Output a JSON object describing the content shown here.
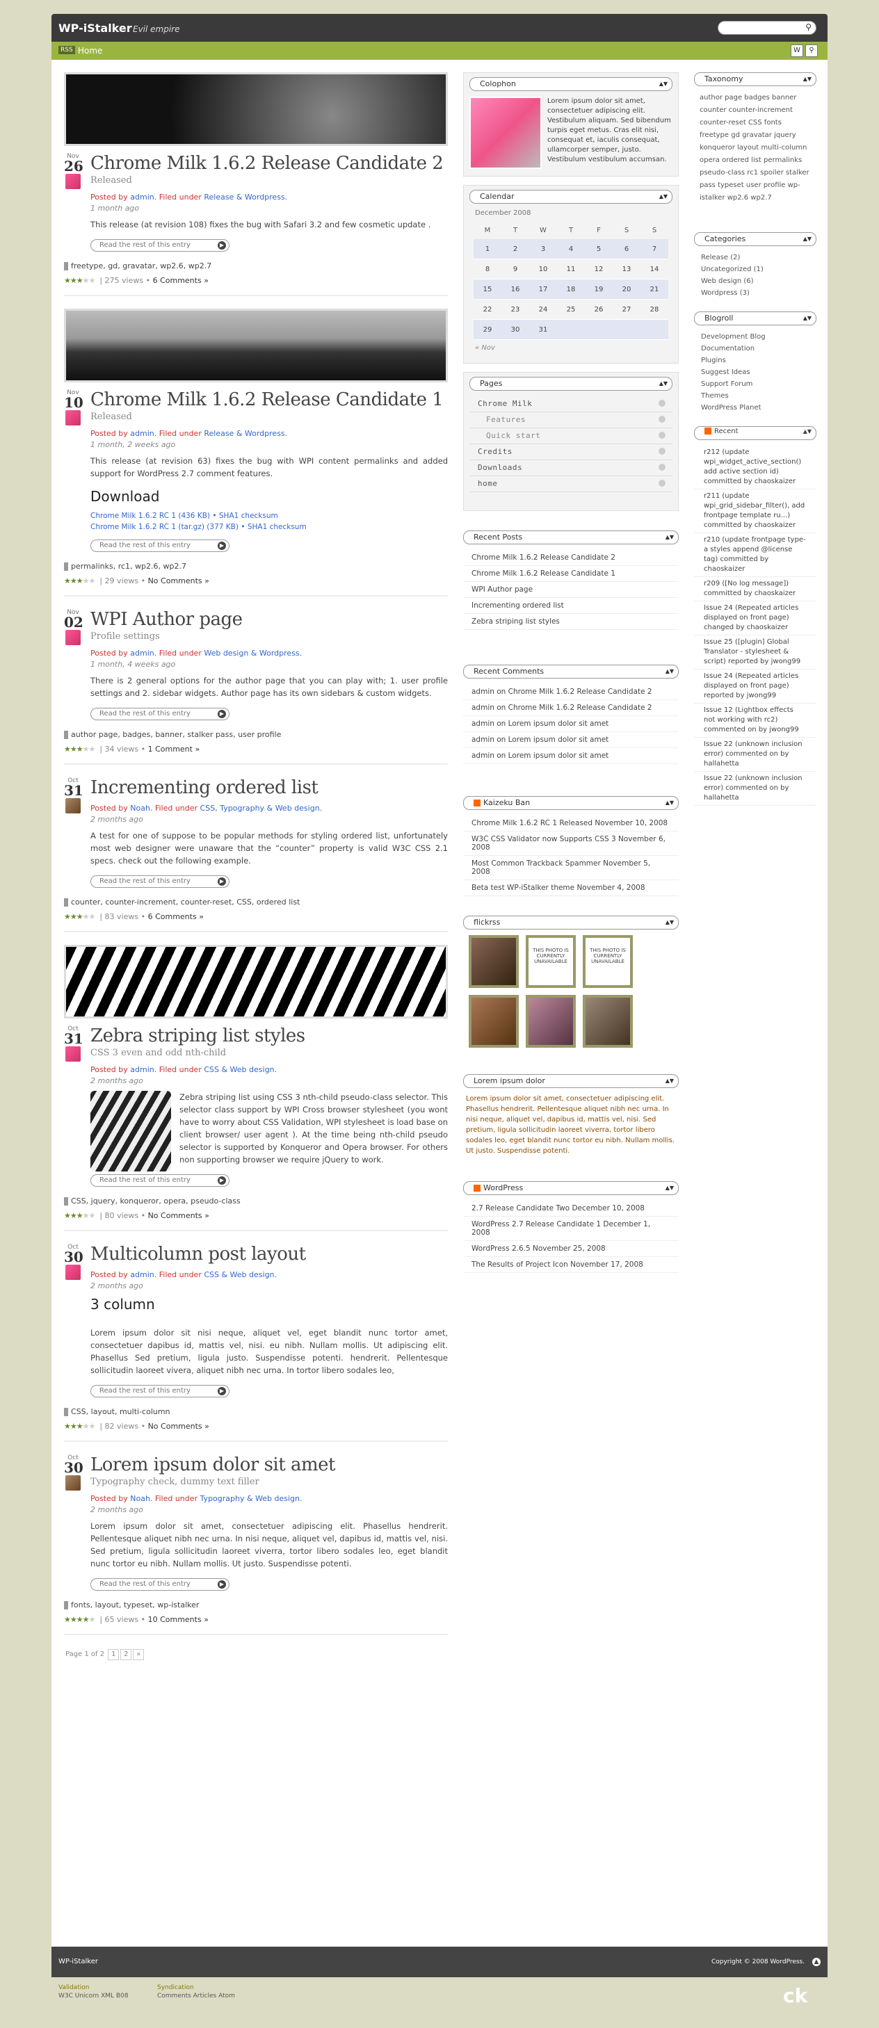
{
  "header": {
    "site_title": "WP-iStalker",
    "tagline": "Evil empire",
    "home": "Home",
    "rss": "RSS"
  },
  "posts": [
    {
      "month": "Nov",
      "day": "26",
      "title": "Chrome Milk 1.6.2 Release Candidate 2",
      "subtitle": "Released",
      "author": "admin",
      "cats": "Release & Wordpress.",
      "ago": "1 month ago",
      "excerpt": "This release (at revision 108) fixes the bug with Safari 3.2 and few cosmetic update .",
      "tags": "freetype, gd, gravatar, wp2.6, wp2.7",
      "views": "275 views",
      "comments": "6 Comments »",
      "stars": 3
    },
    {
      "month": "Nov",
      "day": "10",
      "title": "Chrome Milk 1.6.2 Release Candidate 1",
      "subtitle": "Released",
      "author": "admin",
      "cats": "Release & Wordpress.",
      "ago": "1 month, 2 weeks ago",
      "excerpt": "This release (at revision 63) fixes the bug with WPI content permalinks and added support for WordPress 2.7 comment features.",
      "section": "Download",
      "dl1": "Chrome Milk 1.6.2 RC 1 (436 KB) • SHA1 checksum",
      "dl2": "Chrome Milk 1.6.2 RC 1 (tar.gz) (377 KB) • SHA1 checksum",
      "tags": "permalinks, rc1, wp2.6, wp2.7",
      "views": "29 views",
      "comments": "No Comments »",
      "stars": 3
    },
    {
      "month": "Nov",
      "day": "02",
      "title": "WPI Author page",
      "subtitle": "Profile settings",
      "author": "admin",
      "cats": "Web design & Wordpress.",
      "ago": "1 month, 4 weeks ago",
      "excerpt": "There is 2 general options for the author page that you can play with; 1. user profile settings and 2. sidebar widgets. Author page has its own sidebars & custom widgets.",
      "tags": "author page, badges, banner, stalker pass, user profile",
      "views": "34 views",
      "comments": "1 Comment »",
      "stars": 3
    },
    {
      "month": "Oct",
      "day": "31",
      "title": "Incrementing ordered list",
      "subtitle": "",
      "author": "Noah",
      "cats": "CSS, Typography & Web design.",
      "ago": "2 months ago",
      "excerpt": "A test for one of suppose to be popular methods for styling ordered list, unfortunately most web designer were unaware that the “counter” property is valid W3C CSS 2.1 specs. check out the following example.",
      "tags": "counter, counter-increment, counter-reset, CSS, ordered list",
      "views": "83 views",
      "comments": "6 Comments »",
      "stars": 3
    },
    {
      "month": "Oct",
      "day": "31",
      "title": "Zebra striping list styles",
      "subtitle": "CSS 3 even and odd nth-child",
      "author": "admin",
      "cats": "CSS & Web design.",
      "ago": "2 months ago",
      "excerpt": "Zebra striping list using CSS 3 nth-child pseudo-class selector. This selector class support by WPI Cross browser stylesheet (you wont have to worry about CSS Validation, WPI stylesheet is load base on client browser/ user agent ). At the time being nth-child pseudo selector is supported by Konqueror and Opera browser. For others non supporting browser we require jQuery to work.",
      "tags": "CSS, jquery, konqueror, opera, pseudo-class",
      "views": "80 views",
      "comments": "No Comments »",
      "stars": 3
    },
    {
      "month": "Oct",
      "day": "30",
      "title": "Multicolumn post layout",
      "subtitle": "",
      "author": "admin",
      "cats": "CSS & Web design.",
      "ago": "2 months ago",
      "section": "3 column",
      "excerpt": "Lorem ipsum dolor sit nisi neque, aliquet vel, eget blandit nunc tortor amet, consectetuer dapibus id, mattis vel, nisi. eu nibh. Nullam mollis. Ut adipiscing elit. Phasellus Sed pretium, ligula justo. Suspendisse potenti. hendrerit. Pellentesque sollicitudin laoreet vivera, aliquet nibh nec urna. In tortor libero sodales leo,",
      "tags": "CSS, layout, multi-column",
      "views": "82 views",
      "comments": "No Comments »",
      "stars": 3
    },
    {
      "month": "Oct",
      "day": "30",
      "title": "Lorem ipsum dolor sit amet",
      "subtitle": "Typography check, dummy text filler",
      "author": "Noah",
      "cats": "Typography & Web design.",
      "ago": "2 months ago",
      "excerpt": "Lorem ipsum dolor sit amet, consectetuer adipiscing elit. Phasellus hendrerit. Pellentesque aliquet nibh nec urna. In nisi neque, aliquet vel, dapibus id, mattis vel, nisi. Sed pretium, ligula sollicitudin laoreet viverra, tortor libero sodales leo, eget blandit nunc tortor eu nibh. Nullam mollis. Ut justo. Suspendisse potenti.",
      "tags": "fonts, layout, typeset, wp-istalker",
      "views": "65 views",
      "comments": "10 Comments »",
      "stars": 4
    }
  ],
  "labels": {
    "posted_by": "Posted by",
    "filed": "Filed under",
    "more": "Read the rest of this entry",
    "pager": "Page 1 of 2"
  },
  "colophon": {
    "title": "Colophon",
    "text": "Lorem ipsum dolor sit amet, consectetuer adipiscing elit. Vestibulum aliquam. Sed bibendum turpis eget metus. Cras elit nisi, consequat et, iaculis consequat, ullamcorper semper, justo. Vestibulum vestibulum accumsan."
  },
  "calendar": {
    "title": "Calendar",
    "caption": "December 2008",
    "days": [
      "M",
      "T",
      "W",
      "T",
      "F",
      "S",
      "S"
    ],
    "prev": "« Nov"
  },
  "pages": {
    "title": "Pages",
    "items": [
      "Chrome Milk",
      "Features",
      "Quick start",
      "Credits",
      "Downloads",
      "home"
    ]
  },
  "recent_posts": {
    "title": "Recent Posts",
    "items": [
      "Chrome Milk 1.6.2 Release Candidate 2",
      "Chrome Milk 1.6.2 Release Candidate 1",
      "WPI Author page",
      "Incrementing ordered list",
      "Zebra striping list styles"
    ]
  },
  "recent_comments": {
    "title": "Recent Comments",
    "items": [
      "admin on Chrome Milk 1.6.2 Release Candidate 2",
      "admin on Chrome Milk 1.6.2 Release Candidate 2",
      "admin on Lorem ipsum dolor sit amet",
      "admin on Lorem ipsum dolor sit amet",
      "admin on Lorem ipsum dolor sit amet"
    ]
  },
  "kaizeku": {
    "title": "Kaizeku Ban",
    "items": [
      "Chrome Milk 1.6.2 RC 1 Released November 10, 2008",
      "W3C CSS Validator now Supports CSS 3 November 6, 2008",
      "Most Common Trackback Spammer November 5, 2008",
      "Beta test WP-iStalker theme November 4, 2008"
    ]
  },
  "flickrss": {
    "title": "flickrss",
    "unavailable": "THIS PHOTO IS CURRENTLY UNAVAILABLE"
  },
  "lorem_widget": {
    "title": "Lorem ipsum dolor",
    "text": "Lorem ipsum dolor sit amet, consectetuer adipiscing elit. Phasellus hendrerit. Pellentesque aliquet nibh nec urna. In nisi neque, aliquet vel, dapibus id, mattis vel, nisi. Sed pretium, ligula sollicitudin laoreet viverra, tortor libero sodales leo, eget blandit nunc tortor eu nibh. Nullam mollis. Ut justo. Suspendisse potenti."
  },
  "wordpress": {
    "title": "WordPress",
    "items": [
      "2.7 Release Candidate Two December 10, 2008",
      "WordPress 2.7 Release Candidate 1 December 1, 2008",
      "WordPress 2.6.5 November 25, 2008",
      "The Results of Project Icon November 17, 2008"
    ]
  },
  "taxonomy": {
    "title": "Taxonomy",
    "text": "author page badges banner counter counter-increment counter-reset CSS fonts freetype gd gravatar jquery konqueror layout multi-column opera ordered list permalinks pseudo-class rc1 spoiler stalker pass typeset user profile wp-istalker wp2.6 wp2.7"
  },
  "categories": {
    "title": "Categories",
    "items": [
      "Release (2)",
      "Uncategorized (1)",
      "Web design (6)",
      "Wordpress (3)"
    ]
  },
  "blogroll": {
    "title": "Blogroll",
    "items": [
      "Development Blog",
      "Documentation",
      "Plugins",
      "Suggest Ideas",
      "Support Forum",
      "Themes",
      "WordPress Planet"
    ]
  },
  "recent_svn": {
    "title": "Recent",
    "items": [
      "r212 (update wpi_widget_active_section() add active section id) committed by chaoskaizer",
      "r211 (update wpi_grid_sidebar_filter(), add frontpage template ru...) committed by chaoskaizer",
      "r210 (update frontpage type-a styles append @license tag) committed by chaoskaizer",
      "r209 ([No log message]) committed by chaoskaizer",
      "Issue 24 (Repeated articles displayed on front page) changed by chaoskaizer",
      "Issue 25 ([plugin] Global Translator - stylesheet & script) reported by jwong99",
      "Issue 24 (Repeated articles displayed on front page) reported by jwong99",
      "Issue 12 (Lightbox effects not working with rc2) commented on by jwong99",
      "Issue 22 (unknown inclusion error) commented on by hallahetta",
      "Issue 22 (unknown inclusion error) commented on by hallahetta"
    ]
  },
  "footer": {
    "left": "WP-iStalker",
    "right": "Copyright © 2008 WordPress.",
    "validation": "Validation",
    "validation_links": "W3C Unicorn   XML   B08",
    "syndication": "Syndication",
    "syndication_links": "Comments   Articles   Atom"
  }
}
